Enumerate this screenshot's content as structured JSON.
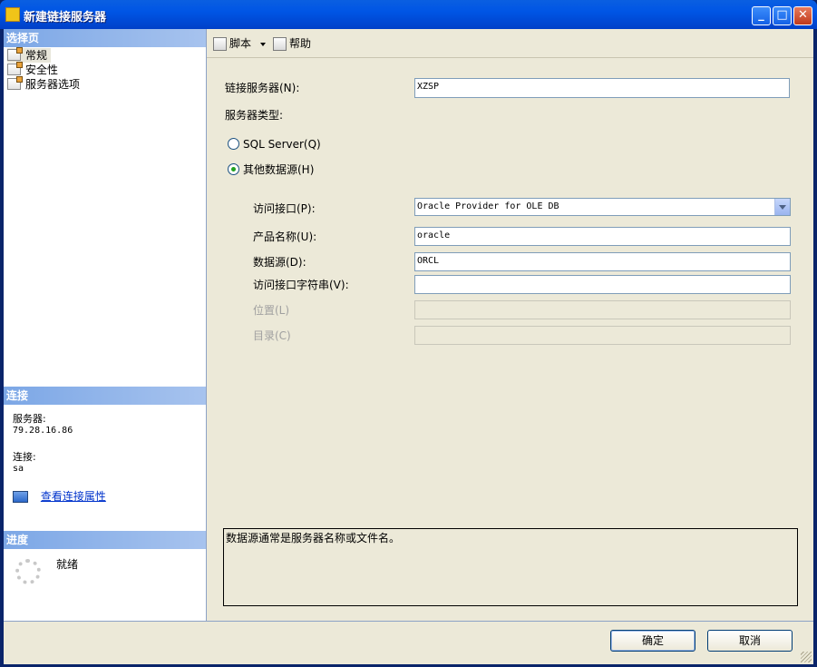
{
  "window": {
    "title": "新建链接服务器",
    "minimize_glyph": "_",
    "maximize_glyph": "□",
    "close_glyph": "✕"
  },
  "left": {
    "select_page_header": "选择页",
    "pages": [
      {
        "label": "常规",
        "icon": "page-icon",
        "selected": true
      },
      {
        "label": "安全性",
        "icon": "page-icon",
        "selected": false
      },
      {
        "label": "服务器选项",
        "icon": "page-icon",
        "selected": false
      }
    ],
    "connection_header": "连接",
    "server_label": "服务器:",
    "server_value": "79.28.16.86",
    "conn_label": "连接:",
    "conn_value": "sa",
    "view_props_link": "查看连接属性",
    "progress_header": "进度",
    "progress_status": "就绪"
  },
  "toolbar": {
    "script_label": "脚本",
    "help_label": "帮助"
  },
  "form": {
    "linked_server_label": "链接服务器(N):",
    "linked_server_value": "XZSP",
    "server_type_label": "服务器类型:",
    "radio_sql_label": "SQL Server(Q)",
    "radio_other_label": "其他数据源(H)",
    "provider_label": "访问接口(P):",
    "provider_value": "Oracle Provider for OLE DB",
    "product_label": "产品名称(U):",
    "product_value": "oracle",
    "datasource_label": "数据源(D):",
    "datasource_value": "ORCL",
    "provstring_label": "访问接口字符串(V):",
    "provstring_value": "",
    "location_label": "位置(L)",
    "catalog_label": "目录(C)"
  },
  "help_text": "数据源通常是服务器名称或文件名。",
  "buttons": {
    "ok": "确定",
    "cancel": "取消"
  },
  "colors": {
    "title_bar": "#0055e5",
    "section_header": "#7ca7e6",
    "link": "#0033cc"
  }
}
